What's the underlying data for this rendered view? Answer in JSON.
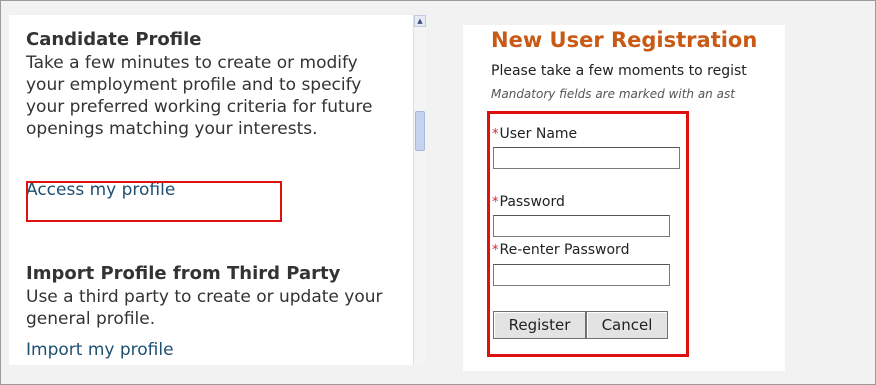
{
  "candidate_profile": {
    "title": "Candidate Profile",
    "description": "Take a few minutes to create or modify your employment profile and to specify your preferred working criteria for future openings matching your interests.",
    "link": "Access my profile"
  },
  "import_profile": {
    "title": "Import Profile from Third Party",
    "description": "Use a third party to create or update your general profile.",
    "link": "Import my profile"
  },
  "registration": {
    "title": "New User Registration",
    "intro": "Please take a few moments to regist",
    "mandatory_note": "Mandatory fields are marked with an ast",
    "required_marker": "*",
    "fields": {
      "username_label": "User Name",
      "username_value": "",
      "password_label": "Password",
      "password_value": "",
      "reenter_label": "Re-enter Password",
      "reenter_value": ""
    },
    "register_button": "Register",
    "cancel_button": "Cancel"
  },
  "colors": {
    "title_orange": "#c85a16",
    "link_blue": "#1d4f72",
    "highlight_red": "#e01010"
  }
}
